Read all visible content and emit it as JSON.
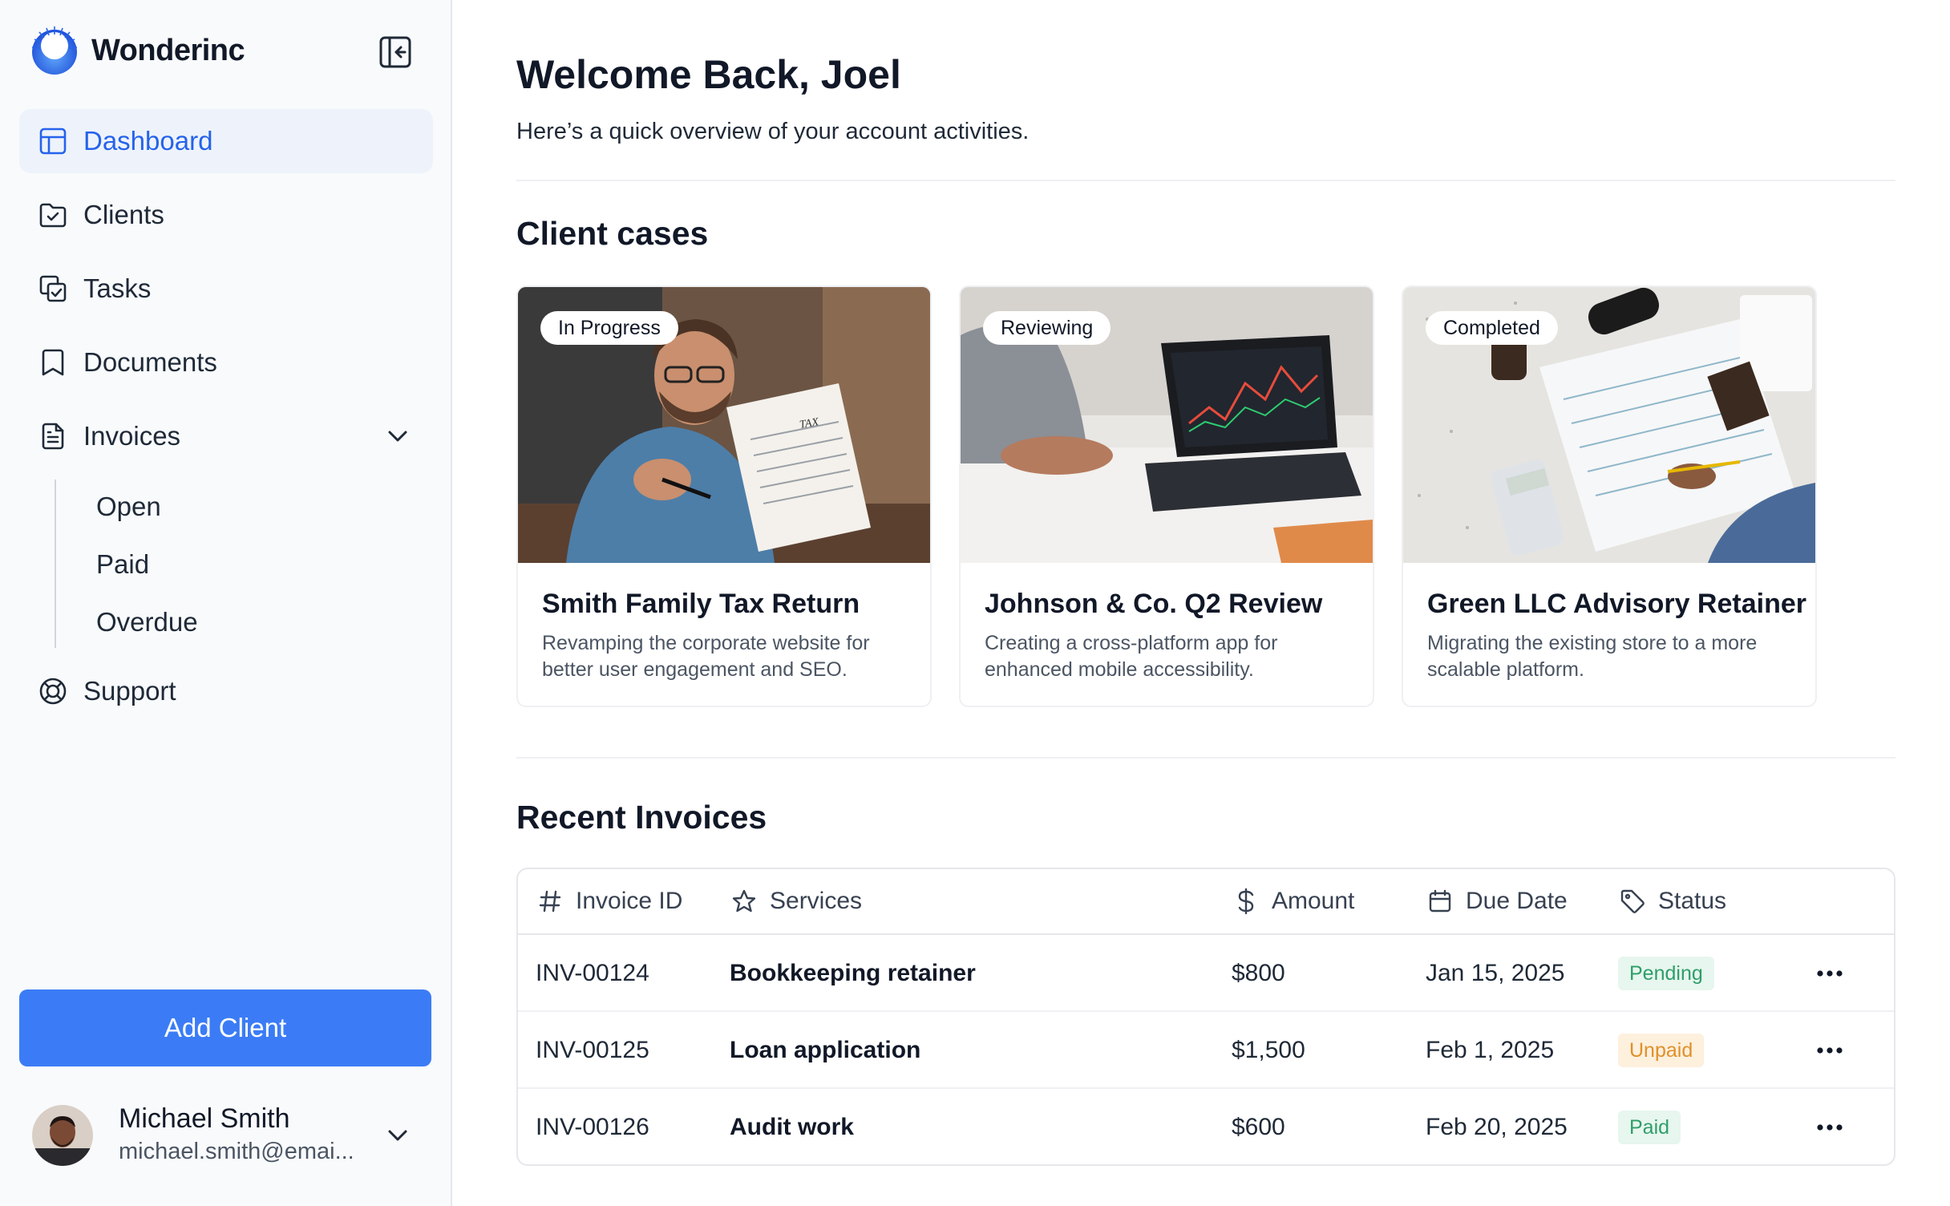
{
  "brand": {
    "name": "Wonderinc"
  },
  "sidebar": {
    "items": [
      {
        "label": "Dashboard",
        "icon": "layout-icon"
      },
      {
        "label": "Clients",
        "icon": "folder-check-icon"
      },
      {
        "label": "Tasks",
        "icon": "copy-check-icon"
      },
      {
        "label": "Documents",
        "icon": "book-icon"
      },
      {
        "label": "Invoices",
        "icon": "file-text-icon"
      },
      {
        "label": "Support",
        "icon": "lifebuoy-icon"
      }
    ],
    "invoice_subitems": [
      "Open",
      "Paid",
      "Overdue"
    ],
    "add_client_label": "Add Client"
  },
  "user": {
    "name": "Michael Smith",
    "email": "michael.smith@emai..."
  },
  "header": {
    "title": "Welcome Back, Joel",
    "subtitle": "Here’s a quick overview of your account activities."
  },
  "client_cases": {
    "title": "Client cases",
    "cards": [
      {
        "status": "In Progress",
        "title": "Smith Family Tax Return",
        "description": "Revamping the corporate website for better user engagement and SEO."
      },
      {
        "status": "Reviewing",
        "title": "Johnson & Co. Q2 Review",
        "description": "Creating a cross-platform app for enhanced mobile accessibility."
      },
      {
        "status": "Completed",
        "title": "Green LLC Advisory Retainer",
        "description": "Migrating the existing store to a more scalable platform."
      }
    ]
  },
  "invoices": {
    "title": "Recent Invoices",
    "columns": [
      "Invoice ID",
      "Services",
      "Amount",
      "Due Date",
      "Status"
    ],
    "rows": [
      {
        "id": "INV-00124",
        "service": "Bookkeeping retainer",
        "amount": "$800",
        "due": "Jan 15, 2025",
        "status": "Pending"
      },
      {
        "id": "INV-00125",
        "service": "Loan application",
        "amount": "$1,500",
        "due": "Feb 1, 2025",
        "status": "Unpaid"
      },
      {
        "id": "INV-00126",
        "service": "Audit work",
        "amount": "$600",
        "due": "Feb 20, 2025",
        "status": "Paid"
      }
    ]
  },
  "colors": {
    "accent": "#3b7cf6",
    "active_text": "#2563eb",
    "pending_bg": "#e7f6ee",
    "pending_text": "#2f9e6a",
    "unpaid_bg": "#fdf0dd",
    "unpaid_text": "#e0902a",
    "paid_bg": "#e7f6ee",
    "paid_text": "#2f9e6a"
  }
}
